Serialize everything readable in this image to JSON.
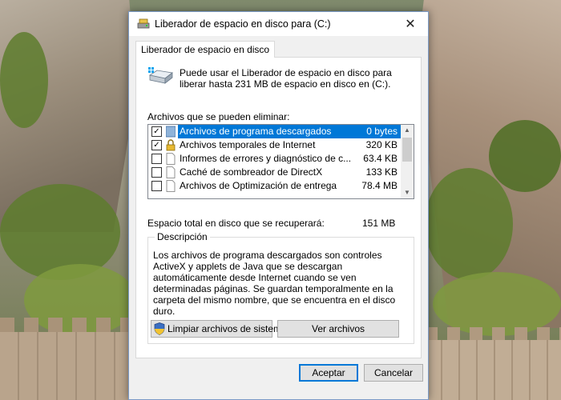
{
  "window": {
    "title": "Liberador de espacio en disco para  (C:)",
    "close_glyph": "✕"
  },
  "tab": {
    "label": "Liberador de espacio en disco"
  },
  "intro": "Puede usar el Liberador de espacio en disco para liberar hasta 231 MB de espacio en disco en  (C:).",
  "files_label": "Archivos que se pueden eliminar:",
  "files": [
    {
      "name": "Archivos de programa descargados",
      "size": "0 bytes",
      "checked": true,
      "selected": true,
      "icon": "folder-icon"
    },
    {
      "name": "Archivos temporales de Internet",
      "size": "320 KB",
      "checked": true,
      "selected": false,
      "icon": "lock-icon"
    },
    {
      "name": "Informes de errores y diagnóstico de c...",
      "size": "63.4 KB",
      "checked": false,
      "selected": false,
      "icon": "file-icon"
    },
    {
      "name": "Caché de sombreador de DirectX",
      "size": "133 KB",
      "checked": false,
      "selected": false,
      "icon": "file-icon"
    },
    {
      "name": "Archivos de Optimización de entrega",
      "size": "78.4 MB",
      "checked": false,
      "selected": false,
      "icon": "file-icon"
    }
  ],
  "total": {
    "label": "Espacio total en disco que se recuperará:",
    "value": "151 MB"
  },
  "description": {
    "legend": "Descripción",
    "text": "Los archivos de programa descargados son controles ActiveX y applets de Java que se descargan automáticamente desde Internet cuando se ven determinadas páginas. Se guardan temporalmente en la carpeta del mismo nombre, que se encuentra en el disco duro."
  },
  "buttons": {
    "clean_system": "Limpiar archivos de sistema",
    "view_files": "Ver archivos",
    "ok": "Aceptar",
    "cancel": "Cancelar"
  },
  "colors": {
    "selection": "#0078d7",
    "dialog_bg": "#f0f0f0",
    "border": "#7a9ac7"
  }
}
